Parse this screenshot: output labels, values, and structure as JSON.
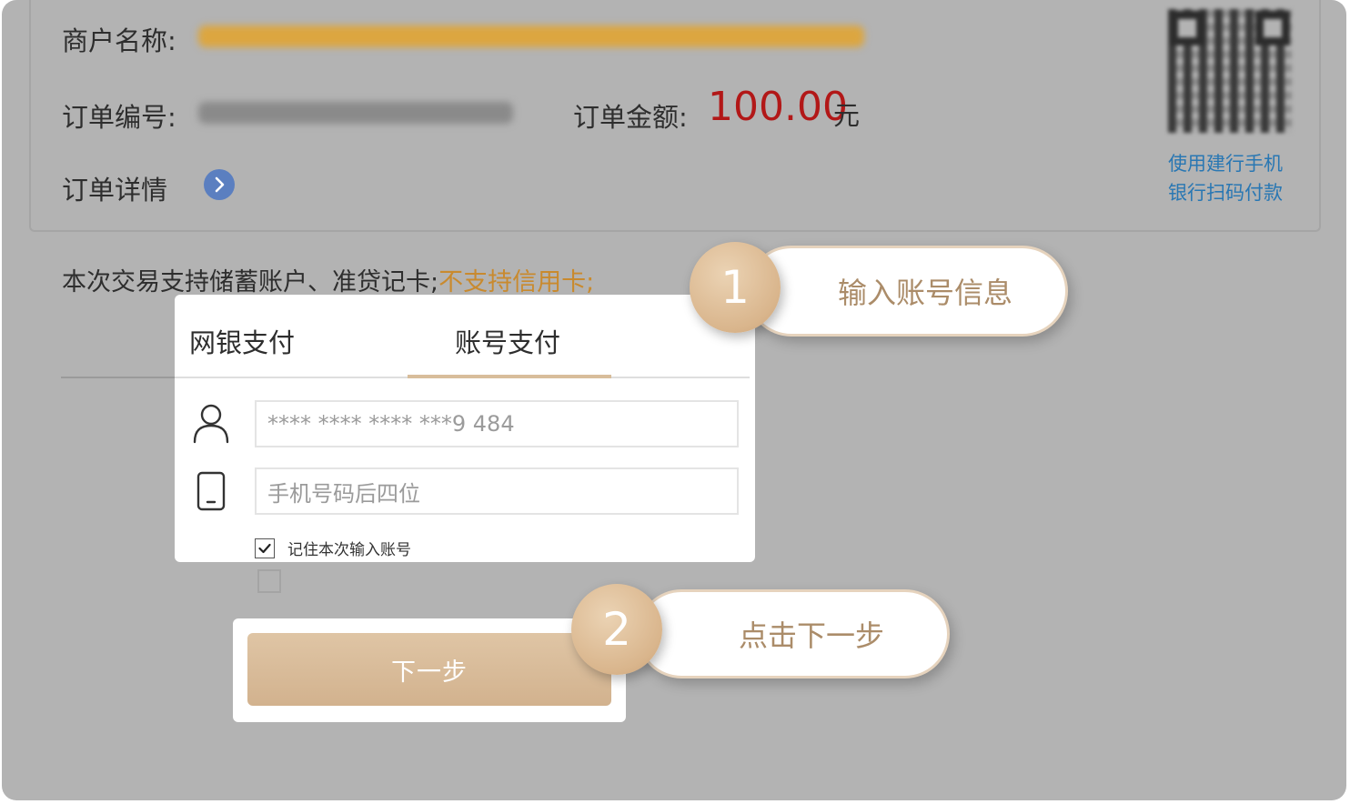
{
  "order": {
    "merchant_label": "商户名称:",
    "order_no_label": "订单编号:",
    "amount_label": "订单金额:",
    "amount_value": "100.00",
    "amount_unit": "元",
    "detail_label": "订单详情"
  },
  "qr": {
    "caption_line1": "使用建行手机",
    "caption_line2": "银行扫码付款"
  },
  "support": {
    "text": "本次交易支持储蓄账户、准贷记卡;",
    "warning": "不支持信用卡;"
  },
  "tabs": [
    {
      "label": "网银支付",
      "active": false
    },
    {
      "label": "账号支付",
      "active": true
    }
  ],
  "form": {
    "account_value": "**** **** **** ***9 484",
    "phone_placeholder": "手机号码后四位",
    "remember_label": "记住本次输入账号",
    "remember_checked": true
  },
  "next_button_label": "下一步",
  "callouts": [
    {
      "step": "1",
      "text": "输入账号信息"
    },
    {
      "step": "2",
      "text": "点击下一步"
    }
  ],
  "colors": {
    "overlay": "#b3b3b3",
    "accent_gold": "#d8bd9b",
    "amount_red": "#b21818",
    "warning_orange": "#c98a2e",
    "link_blue": "#2977b3",
    "detail_button_blue": "#5b7fc0"
  },
  "icons": {
    "detail": "chevron-right-icon",
    "account": "user-icon",
    "phone": "mobile-phone-icon",
    "checkbox": "checkmark-icon"
  }
}
